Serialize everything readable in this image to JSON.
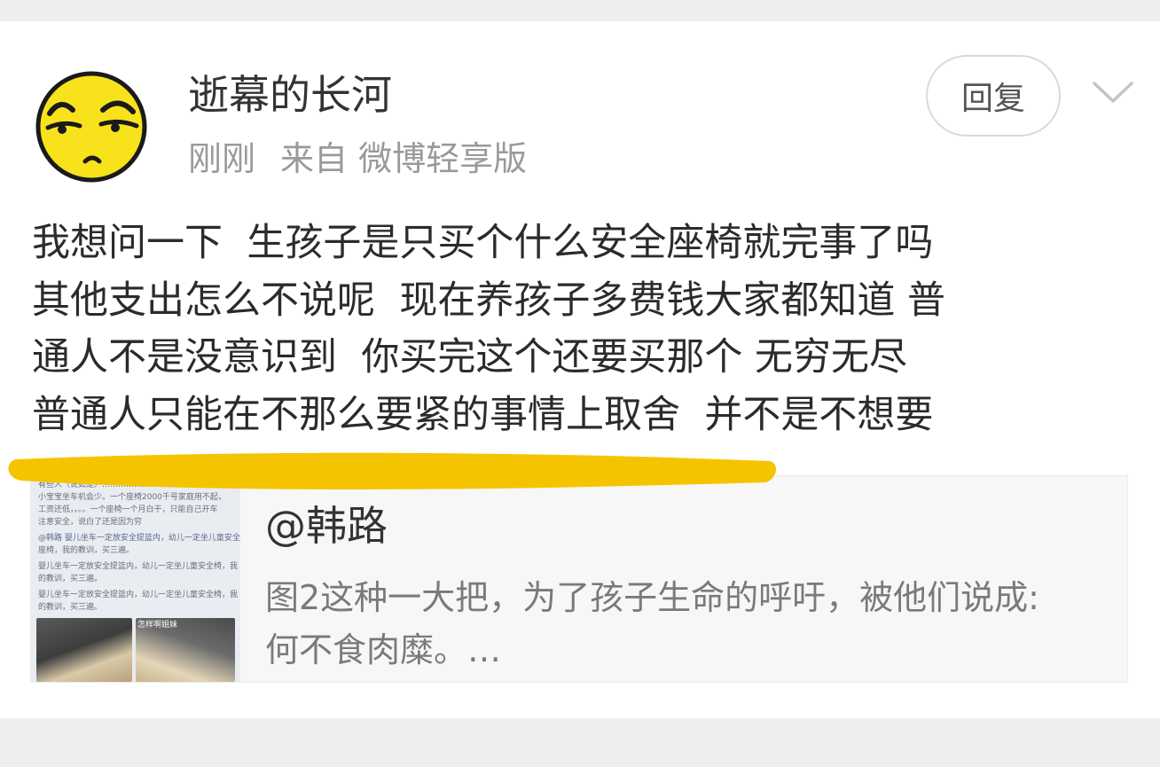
{
  "post": {
    "username": "逝幕的长河",
    "time": "刚刚",
    "source": "来自 微博轻享版",
    "reply_button": "回复",
    "text_lines": [
      "我想问一下  生孩子是只买个什么安全座椅就完事了吗",
      "其他支出怎么不说呢  现在养孩子多费钱大家都知道 普",
      "通人不是没意识到  你买完这个还要买那个 无穷无尽",
      "普通人只能在不那么要紧的事情上取舍  并不是不想要"
    ]
  },
  "quote": {
    "author": "@韩路",
    "body_lines": [
      "图2这种一大把，为了孩子生命的呼吁，被他们说成:",
      "何不食肉糜。…"
    ],
    "thumbnail_lines": [
      "有些人（说如是）…………………",
      "小宝宝坐车机会少。一个座椅2000千号家庭用不起，",
      "工资还低，。。。一个座椅一个月白干，只能自己开车",
      "注意安全，说白了还是因为穷",
      "@韩路  婴儿坐车一定放安全提篮内，幼儿一定坐儿童安全",
      "座椅，我的教训，买三遍。",
      "婴儿坐车一定放安全提篮内，幼儿一定坐儿童安全椅，我",
      "的教训，买三遍。",
      "婴儿坐车一定放安全提篮内，幼儿一定坐儿童安全椅，我",
      "的教训，买三遍。",
      "怎样啊姐妹"
    ]
  },
  "icons": {
    "avatar": "emoji-smirk-face-avatar",
    "more": "chevron-down-icon"
  },
  "colors": {
    "highlight": "#f5c400",
    "avatar_face": "#f7e21c"
  }
}
